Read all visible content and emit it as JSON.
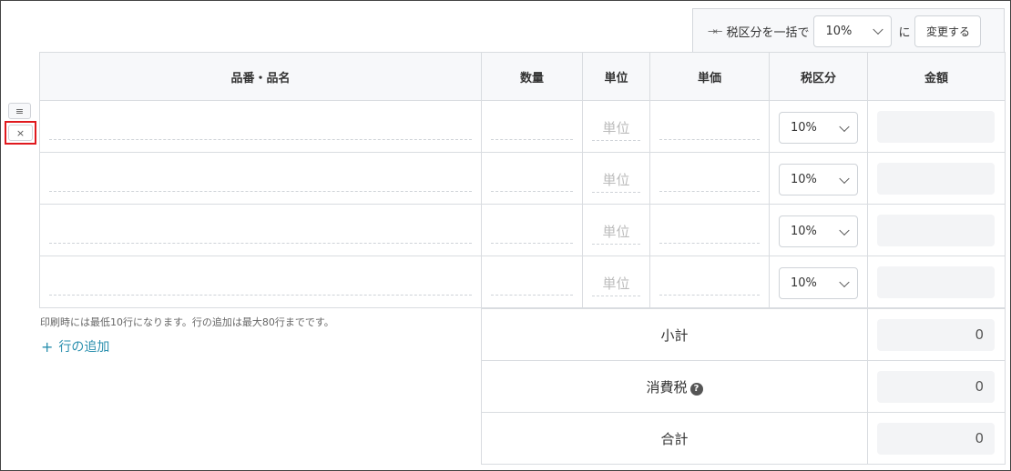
{
  "bulk_tax": {
    "label": "税区分を一括で",
    "selected": "10%",
    "suffix": "に",
    "button": "変更する"
  },
  "table": {
    "headers": [
      "品番・品名",
      "数量",
      "単位",
      "単価",
      "税区分",
      "金額"
    ],
    "rows": [
      {
        "unit_placeholder": "単位",
        "tax": "10%"
      },
      {
        "unit_placeholder": "単位",
        "tax": "10%"
      },
      {
        "unit_placeholder": "単位",
        "tax": "10%"
      },
      {
        "unit_placeholder": "単位",
        "tax": "10%"
      }
    ]
  },
  "row_controls": {
    "handle_glyph": "≡",
    "delete_glyph": "×"
  },
  "notes": {
    "print_note": "印刷時には最低10行になります。行の追加は最大80行までです。",
    "add_row": "行の追加",
    "add_plus": "+"
  },
  "summary": {
    "subtotal_label": "小計",
    "subtotal_value": "0",
    "tax_label": "消費税",
    "tax_value": "0",
    "total_label": "合計",
    "total_value": "0",
    "help_glyph": "?"
  },
  "icons": {
    "bulk_arrows": "arrows-icon",
    "dropdown": "chevron-down-icon",
    "help": "question-circle-icon"
  },
  "colors": {
    "accent_link": "#2a8fae",
    "highlight_border": "#e0191e",
    "header_bg": "#f7f8fa"
  }
}
